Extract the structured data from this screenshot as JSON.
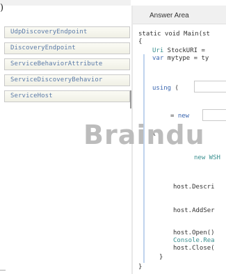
{
  "page": {
    "corner_glyph": ")"
  },
  "options": [
    "UdpDiscoveryEndpoint",
    "DiscoveryEndpoint",
    "ServiceBehaviorAttribute",
    "ServiceDiscoveryBehavior",
    "ServiceHost"
  ],
  "answer": {
    "title": "Answer Area",
    "lines": {
      "l1": "static void Main(st",
      "l2": "{",
      "l3a": "Uri",
      "l3b": " StockURI = ",
      "l4a": "var",
      "l4b": " mytype = ty",
      "l5a": "using",
      "l5b": " (",
      "l6a": "= ",
      "l6b": "new",
      "l7": "{",
      "l8": "new WSH",
      "l9": "host.Descri",
      "l10": "host.AddSer",
      "l11": "host.Open()",
      "l12": "Console.Rea",
      "l13": "host.Close(",
      "l14": "}",
      "l15": "}"
    }
  },
  "watermark": "Braindu"
}
